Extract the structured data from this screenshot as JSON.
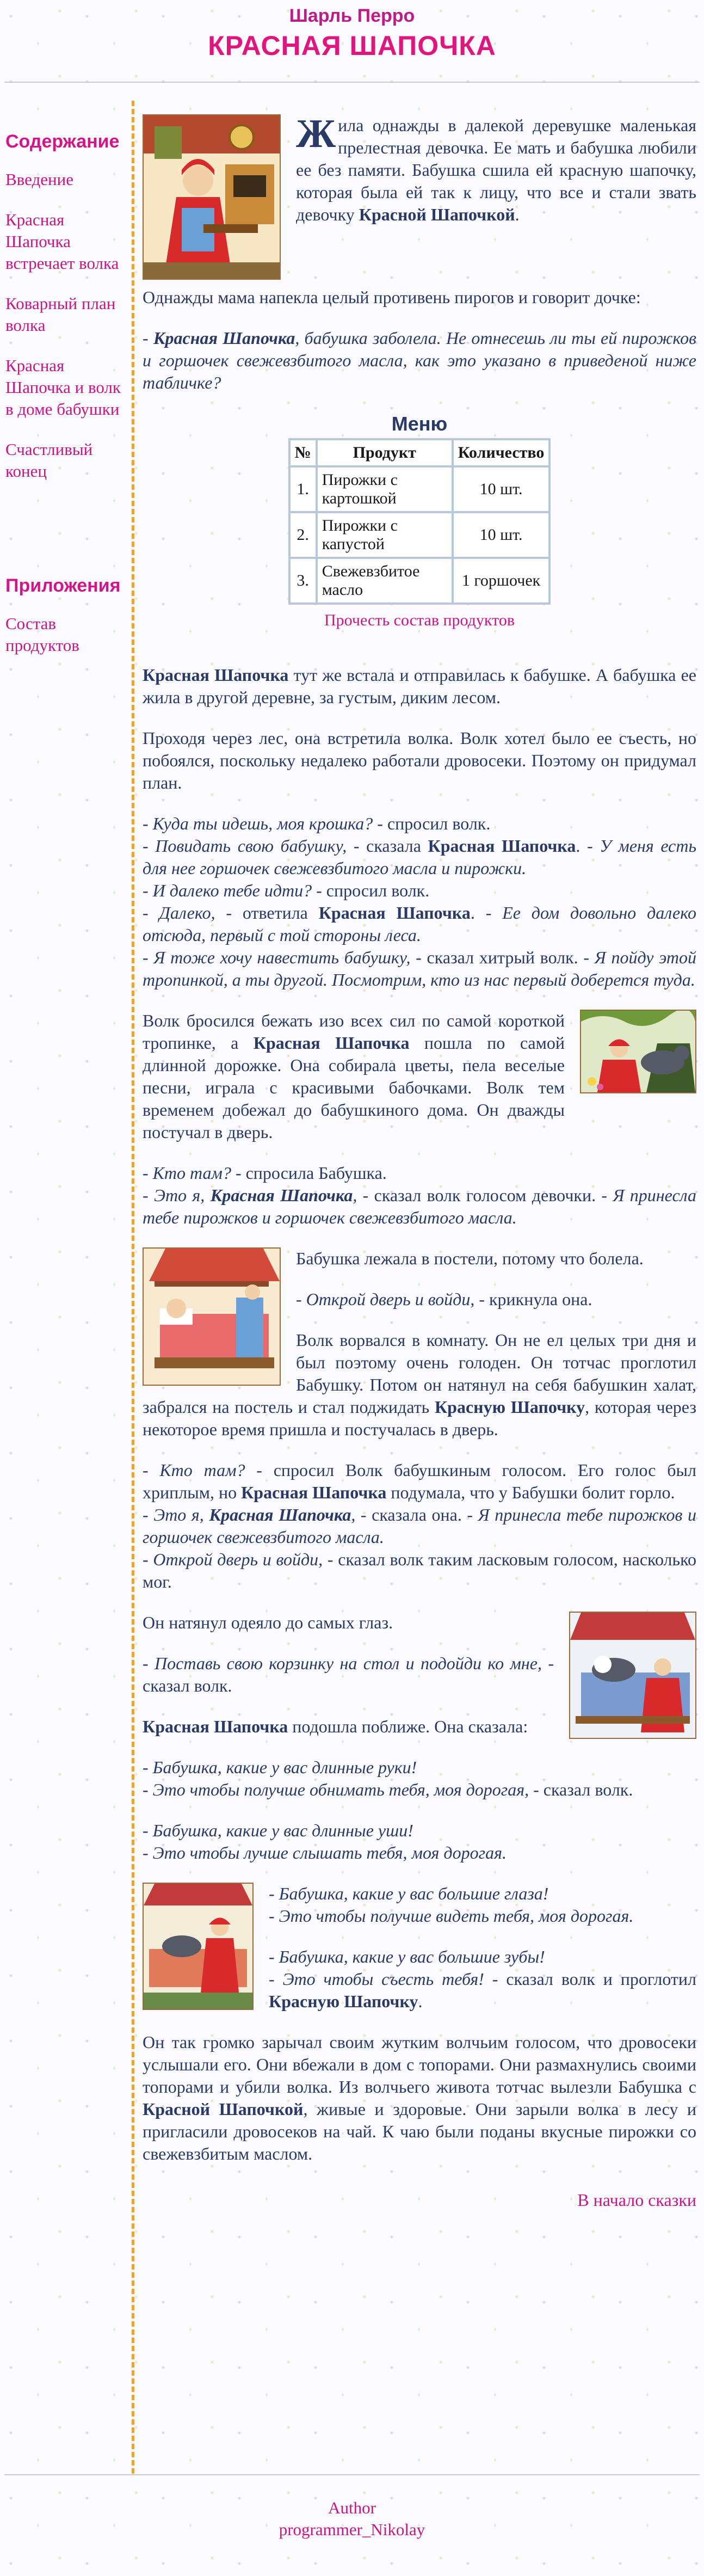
{
  "header": {
    "author": "Шарль Перро",
    "title": "КРАСНАЯ ШАПОЧКА"
  },
  "sidebar": {
    "contents_heading": "Содержание",
    "items": [
      {
        "label": "Введение"
      },
      {
        "label": "Красная Шапочка встречает волка"
      },
      {
        "label": "Коварный план волка"
      },
      {
        "label": "Красная Шапочка и волк в доме бабушки"
      },
      {
        "label": "Счастливый конец"
      }
    ],
    "apps_heading": "Приложения",
    "apps_items": [
      {
        "label": "Состав продуктов"
      }
    ]
  },
  "story": {
    "p1_drop": "Ж",
    "p1_a": "ила однажды в далекой деревушке маленькая прелестная девочка. Ее мать и бабушка любили ее без памяти. Бабушка сшила ей красную шапочку, которая была ей так к лицу, что все и стали звать девочку ",
    "name": "Красной Шапочкой",
    "p1_end": ".",
    "p2": "Однажды мама напекла целый противень пирогов и говорит дочке:",
    "p3_dash": "- ",
    "p3_name": "Красная Шапочка",
    "p3_rest": ", бабушка заболела. Не отнесешь ли ты ей пирожков и горшочек свежевзбитого масла, как это указано в приведеной ниже табличке?",
    "p4_name": "Красная Шапочка",
    "p4_rest": " тут же встала и отправилась к бабушке. А бабушка ее жила в другой деревне, за густым, диким лесом.",
    "p5": "Проходя через лес, она встретила волка. Волк хотел было ее съесть, но побоялся, поскольку недалеко работали дровосеки. Поэтому он придумал план.",
    "d1_a": "- Куда ты идешь, моя крошка?",
    "d1_b": " - спросил волк.",
    "d2_a": "- Повидать свою бабушку,",
    "d2_b": " - сказала ",
    "d2_name": "Красная Шапочка",
    "d2_c": ". - ",
    "d2_d": "У меня есть для нее горшочек свежевзбитого масла и пирожки.",
    "d3_a": "- И далеко тебе идти?",
    "d3_b": " - спросил волк.",
    "d4_a": "- Далеко,",
    "d4_b": " - ответила ",
    "d4_name": "Красная Шапочка",
    "d4_c": ". - ",
    "d4_d": "Ее дом довольно далеко отсюда, первый с той стороны леса.",
    "d5_a": "- Я тоже хочу навестить бабушку,",
    "d5_b": " - сказал хитрый волк. - ",
    "d5_c": "Я пойду этой тропинкой, а ты другой. Посмотрим, кто из нас первый доберется туда.",
    "p6_a": "Волк бросился бежать изо всех сил по самой короткой тропинке, а ",
    "p6_name": "Красная Шапочка",
    "p6_b": " пошла по самой длинной дорожке. Она собирала цветы, пела веселые песни, играла с красивыми бабочками. Волк тем временем добежал до бабушкиного дома. Он дважды постучал в дверь.",
    "d6_a": "- Кто там?",
    "d6_b": " - спросила Бабушка.",
    "d7_a": "- Это я, ",
    "d7_name": "Красная Шапочка",
    "d7_b": ",",
    "d7_c": " - сказал волк голосом девочки. - ",
    "d7_d": "Я принесла тебе пирожков и горшочек свежевзбитого масла.",
    "p7": "Бабушка лежала в постели, потому что болела.",
    "p8_a": "- Открой дверь и войди,",
    "p8_b": " - крикнула она.",
    "p9_a": "Волк ворвался в комнату. Он не ел целых три дня и был поэтому очень голоден. Он тотчас проглотил Бабушку. Потом он натянул на себя бабушкин халат, забрался на постель и стал поджидать ",
    "p9_name": "Красную Шапочку",
    "p9_b": ", которая через некоторое время пришла и постучалась в дверь.",
    "d8_a": "- Кто там?",
    "d8_b": " - спросил Волк бабушкиным голосом. Его голос был хриплым, но ",
    "d8_name": "Красная Шапочка",
    "d8_c": " подумала, что у Бабушки болит горло.",
    "d9_a": "- Это я, ",
    "d9_name": "Красная Шапочка",
    "d9_b": ",",
    "d9_c": " - сказала она. - ",
    "d9_d": "Я принесла тебе пирожков и горшочек свежевзбитого масла.",
    "d10_a": "- Открой дверь и войди,",
    "d10_b": " - сказал волк таким ласковым голосом, насколько мог.",
    "p10": "Он натянул одеяло до самых глаз.",
    "p11_a": "- Поставь свою корзинку на стол и подойди ко мне,",
    "p11_b": " - сказал волк.",
    "p12_name": "Красная Шапочка",
    "p12_rest": " подошла поближе. Она сказала:",
    "d11": "- Бабушка, какие у вас длинные руки!",
    "d12_a": "- Это чтобы получше обнимать тебя, моя дорогая,",
    "d12_b": " - сказал волк.",
    "d13": "- Бабушка, какие у вас длинные уши!",
    "d14": "- Это чтобы лучше слышать тебя, моя дорогая.",
    "d15": "- Бабушка, какие у вас большие глаза!",
    "d16": "- Это чтобы получше видеть тебя, моя дорогая.",
    "d17": "- Бабушка, какие у вас большие зубы!",
    "d18_a": "- Это чтобы съесть тебя!",
    "d18_b": " - сказал волк и проглотил ",
    "d18_name": "Красную Шапочку",
    "d18_c": ".",
    "p13_a": "Он так громко зарычал своим жутким волчьим голосом, что дровосеки услышали его. Они вбежали в дом с топорами. Они размахнулись своими топорами и убили волка. Из волчьего живота тотчас вылезли Бабушка с ",
    "p13_name": "Красной Шапочкой",
    "p13_b": ", живые и здоровые. Они зарыли волка в лесу и пригласили дровосеков на чай. К чаю были поданы вкусные пирожки со свежевзбитым маслом."
  },
  "menu": {
    "title": "Меню",
    "headers": [
      "№",
      "Продукт",
      "Количество"
    ],
    "rows": [
      [
        "1.",
        "Пирожки с картошкой",
        "10 шт."
      ],
      [
        "2.",
        "Пирожки с капустой",
        "10 шт."
      ],
      [
        "3.",
        "Свежевзбитое масло",
        "1 горшочек"
      ]
    ],
    "link": "Прочесть состав продуктов"
  },
  "back_to_top": "В начало сказки",
  "footer": {
    "line1": "Author",
    "line2": "programmer_Nikolay"
  },
  "colors": {
    "accent": "#e0167f",
    "link": "#c6158a",
    "text": "#2a3a66",
    "divider": "#f0a23a"
  },
  "icons": [
    "illustration-girl-baking",
    "illustration-wolf-meets-girl",
    "illustration-grandmother-bed",
    "illustration-wolf-in-bed",
    "illustration-girl-wolf-bed"
  ]
}
